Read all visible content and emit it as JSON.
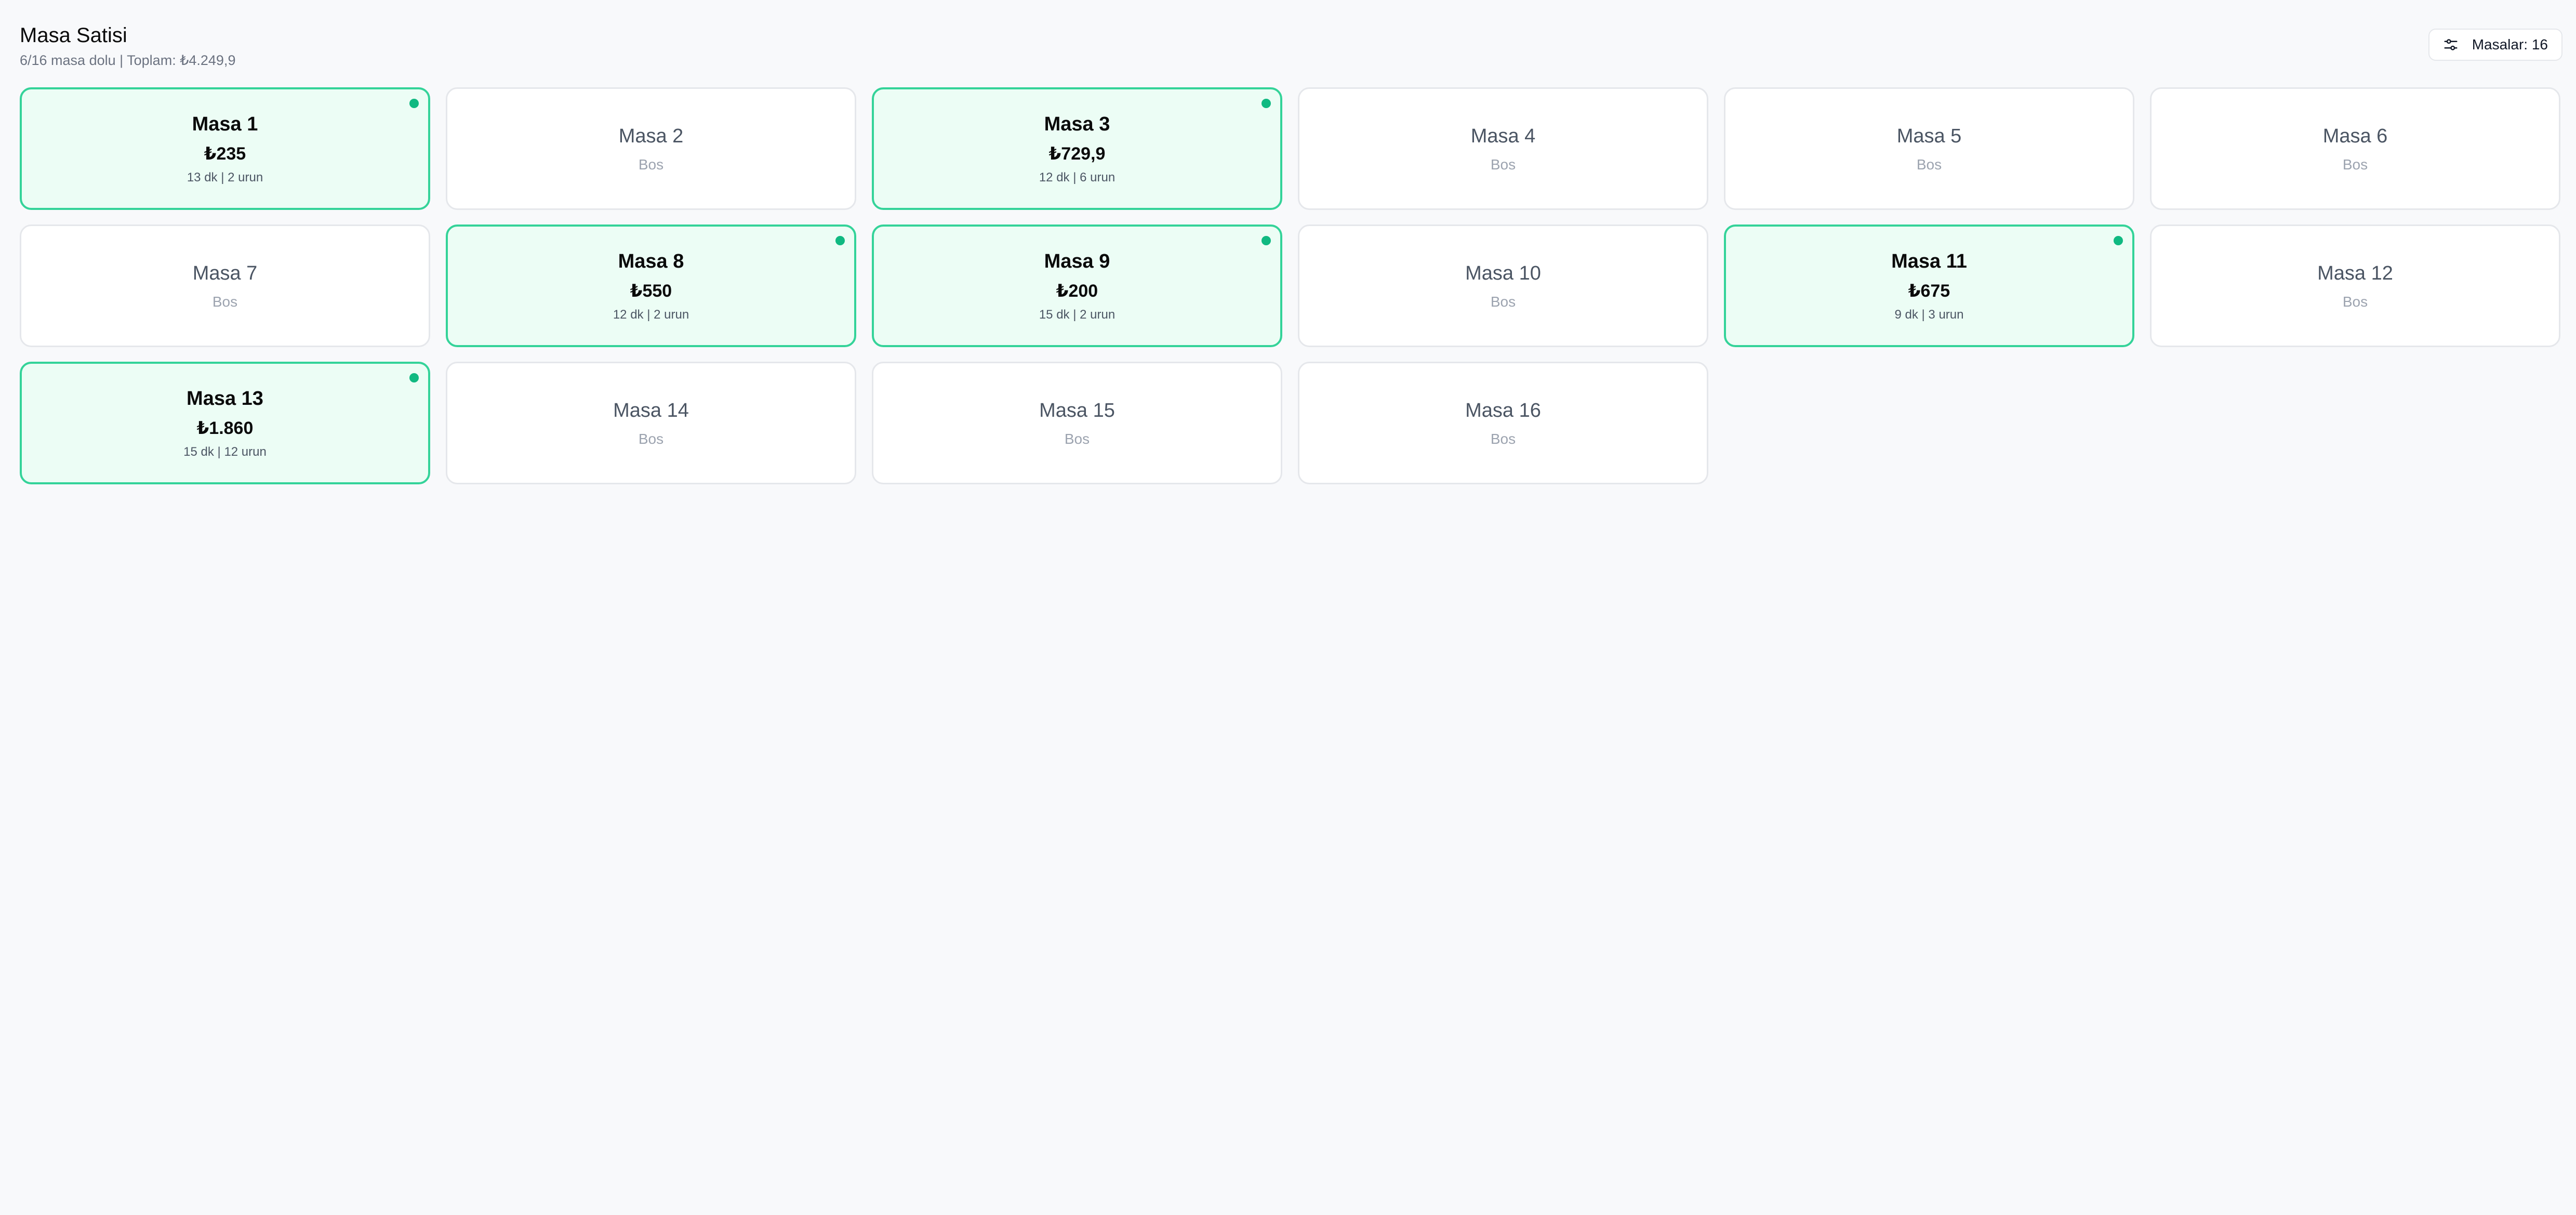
{
  "header": {
    "title": "Masa Satisi",
    "subtitle": "6/16 masa dolu | Toplam: ₺4.249,9",
    "tables_button_label": "Masalar: 16",
    "tables_button_icon": "sliders-icon"
  },
  "colors": {
    "occupied_bg": "#ecfdf5",
    "occupied_border": "#34d399",
    "status_dot": "#10b981",
    "empty_border": "#e5e7eb"
  },
  "tables": [
    {
      "name": "Masa 1",
      "occupied": true,
      "amount": "₺235",
      "meta": "13 dk | 2 urun"
    },
    {
      "name": "Masa 2",
      "occupied": false,
      "status": "Bos"
    },
    {
      "name": "Masa 3",
      "occupied": true,
      "amount": "₺729,9",
      "meta": "12 dk | 6 urun"
    },
    {
      "name": "Masa 4",
      "occupied": false,
      "status": "Bos"
    },
    {
      "name": "Masa 5",
      "occupied": false,
      "status": "Bos"
    },
    {
      "name": "Masa 6",
      "occupied": false,
      "status": "Bos"
    },
    {
      "name": "Masa 7",
      "occupied": false,
      "status": "Bos"
    },
    {
      "name": "Masa 8",
      "occupied": true,
      "amount": "₺550",
      "meta": "12 dk | 2 urun"
    },
    {
      "name": "Masa 9",
      "occupied": true,
      "amount": "₺200",
      "meta": "15 dk | 2 urun"
    },
    {
      "name": "Masa 10",
      "occupied": false,
      "status": "Bos"
    },
    {
      "name": "Masa 11",
      "occupied": true,
      "amount": "₺675",
      "meta": "9 dk | 3 urun"
    },
    {
      "name": "Masa 12",
      "occupied": false,
      "status": "Bos"
    },
    {
      "name": "Masa 13",
      "occupied": true,
      "amount": "₺1.860",
      "meta": "15 dk | 12 urun"
    },
    {
      "name": "Masa 14",
      "occupied": false,
      "status": "Bos"
    },
    {
      "name": "Masa 15",
      "occupied": false,
      "status": "Bos"
    },
    {
      "name": "Masa 16",
      "occupied": false,
      "status": "Bos"
    }
  ]
}
